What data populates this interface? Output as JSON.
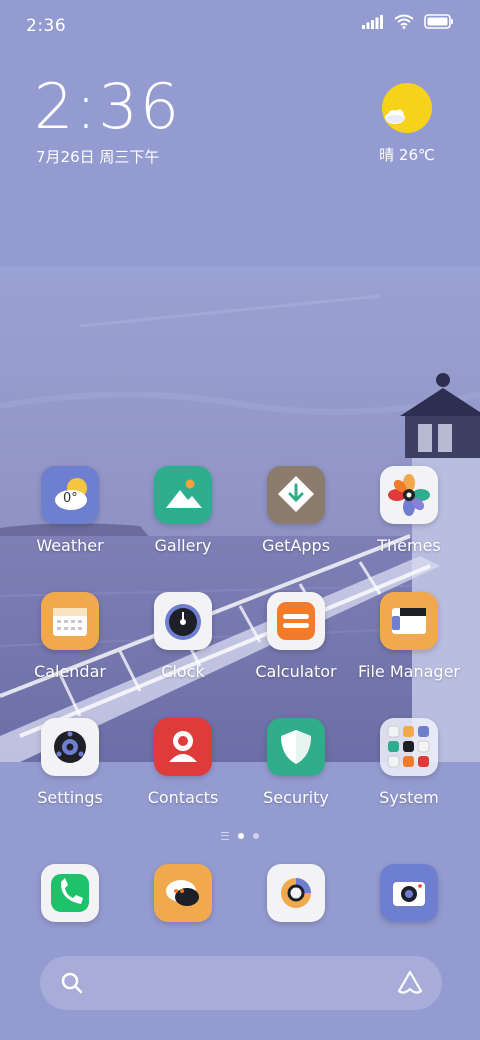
{
  "status_bar": {
    "time": "2:36"
  },
  "clock_widget": {
    "time": "2:36",
    "date": "7月26日 周三下午"
  },
  "weather_widget": {
    "condition": "晴",
    "temperature": "26℃",
    "text": "晴 26℃"
  },
  "apps": [
    {
      "label": "Weather",
      "icon": "weather-icon",
      "badge": "0°"
    },
    {
      "label": "Gallery",
      "icon": "gallery-icon"
    },
    {
      "label": "GetApps",
      "icon": "getapps-icon"
    },
    {
      "label": "Themes",
      "icon": "themes-icon"
    },
    {
      "label": "Calendar",
      "icon": "calendar-icon"
    },
    {
      "label": "Clock",
      "icon": "clock-icon"
    },
    {
      "label": "Calculator",
      "icon": "calculator-icon"
    },
    {
      "label": "File Manager",
      "icon": "file-manager-icon"
    },
    {
      "label": "Settings",
      "icon": "settings-icon"
    },
    {
      "label": "Contacts",
      "icon": "contacts-icon"
    },
    {
      "label": "Security",
      "icon": "security-icon"
    },
    {
      "label": "System",
      "icon": "system-folder-icon"
    }
  ],
  "dock": [
    {
      "app": "Phone",
      "icon": "phone-icon"
    },
    {
      "app": "Messaging",
      "icon": "messaging-icon"
    },
    {
      "app": "Browser",
      "icon": "browser-icon"
    },
    {
      "app": "Camera",
      "icon": "camera-icon"
    }
  ],
  "page_indicator": {
    "pages": 2,
    "active": 1
  },
  "colors": {
    "background": "#949bd0",
    "weather_sun": "#f7d21a",
    "gallery": "#2eae8e",
    "getapps": "#8a7b6c",
    "calendar": "#f0a94d",
    "calculator": "#f27a2b",
    "file_manager": "#f0a94d",
    "contacts": "#df3b3b",
    "security": "#2fae89",
    "phone": "#1ec26a",
    "messaging": "#f0a94d",
    "camera": "#6f7fd0"
  }
}
